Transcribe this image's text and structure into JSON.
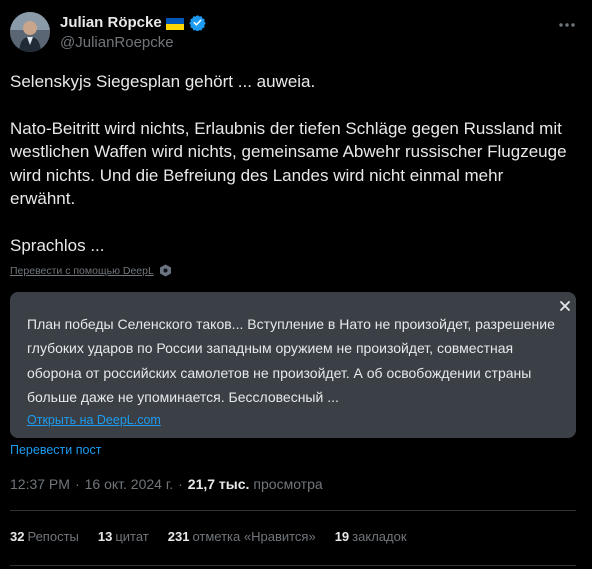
{
  "author": {
    "name": "Julian Röpcke",
    "handle": "@JulianRoepcke"
  },
  "tweet": {
    "line1": "Selenskyjs Siegesplan gehört ... auweia.",
    "line2": "Nato-Beitritt wird nichts, Erlaubnis der tiefen Schläge gegen Russland mit westlichen Waffen wird nichts, gemeinsame Abwehr russischer Flugzeuge wird nichts. Und die Befreiung des Landes wird nicht einmal mehr erwähnt.",
    "line3": "Sprachlos ..."
  },
  "deepl": {
    "translate_with": "Перевести с помощью DeepL",
    "translation": "План победы Селенского таков... Вступление в Нато не произойдет, разрешение глубоких ударов по России западным оружием не произойдет, совместная оборона от российских самолетов не произойдет. А об освобождении страны больше даже не упоминается. Бессловесный ...",
    "open_link": "Открыть на DeepL.com"
  },
  "translate_post": "Перевести пост",
  "meta": {
    "time": "12:37 PM",
    "date": "16 окт. 2024 г.",
    "views": "21,7 тыс.",
    "views_label": "просмотра"
  },
  "stats": [
    {
      "count": "32",
      "label": "Репосты"
    },
    {
      "count": "13",
      "label": "цитат"
    },
    {
      "count": "231",
      "label": "отметка «Нравится»"
    },
    {
      "count": "19",
      "label": "закладок"
    }
  ],
  "colors": {
    "background": "#000000",
    "text": "#e7e9ea",
    "muted": "#71767b",
    "link": "#1d9bf0",
    "translation_box": "#3b4046",
    "verified": "#1d9bf0"
  },
  "icons": [
    "more-icon",
    "verified-badge-icon",
    "ukraine-flag-icon",
    "deepl-icon",
    "close-icon"
  ]
}
